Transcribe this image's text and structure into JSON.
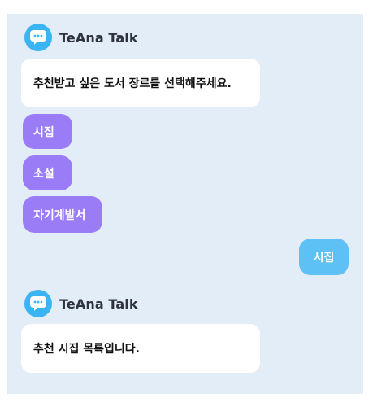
{
  "bot": {
    "name": "TeAna Talk",
    "avatar_icon": "chat-bubble-icon"
  },
  "messages": {
    "prompt": "추천받고 싶은 도서 장르를 선택해주세요.",
    "options": [
      "시집",
      "소설",
      "자기계발서"
    ],
    "user_reply": "시집",
    "result": "추천 시집 목록입니다."
  },
  "colors": {
    "chat_background": "#e2edf8",
    "option_chip": "#9a7cf7",
    "user_bubble": "#5ec1f5",
    "avatar": "#3ab4f2"
  }
}
